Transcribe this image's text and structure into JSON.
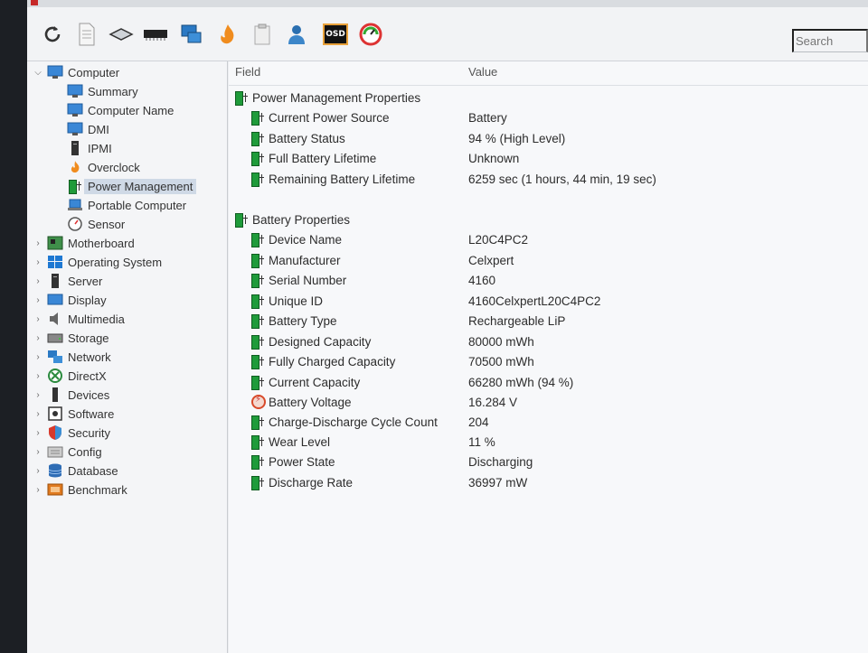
{
  "search": {
    "placeholder": "Search"
  },
  "toolbar": {
    "buttons": [
      "refresh-icon",
      "report-icon",
      "motherboard-icon",
      "memory-icon",
      "network-icon",
      "flame-icon",
      "clipboard-icon",
      "user-icon",
      "osd-icon",
      "gauge-icon"
    ],
    "osd_label": "OSD"
  },
  "sidebar": {
    "items": [
      {
        "label": "Computer",
        "icon": "computer-icon"
      },
      {
        "label": "Summary",
        "icon": "monitor-icon"
      },
      {
        "label": "Computer Name",
        "icon": "monitor-icon"
      },
      {
        "label": "DMI",
        "icon": "monitor-icon"
      },
      {
        "label": "IPMI",
        "icon": "server-icon"
      },
      {
        "label": "Overclock",
        "icon": "flame-icon"
      },
      {
        "label": "Power Management",
        "icon": "battery-icon"
      },
      {
        "label": "Portable Computer",
        "icon": "laptop-icon"
      },
      {
        "label": "Sensor",
        "icon": "gauge-icon"
      },
      {
        "label": "Motherboard",
        "icon": "motherboard-icon"
      },
      {
        "label": "Operating System",
        "icon": "windows-icon"
      },
      {
        "label": "Server",
        "icon": "server-icon"
      },
      {
        "label": "Display",
        "icon": "display-icon"
      },
      {
        "label": "Multimedia",
        "icon": "speaker-icon"
      },
      {
        "label": "Storage",
        "icon": "disk-icon"
      },
      {
        "label": "Network",
        "icon": "network-icon"
      },
      {
        "label": "DirectX",
        "icon": "xbox-icon"
      },
      {
        "label": "Devices",
        "icon": "devices-icon"
      },
      {
        "label": "Software",
        "icon": "software-icon"
      },
      {
        "label": "Security",
        "icon": "shield-icon"
      },
      {
        "label": "Config",
        "icon": "config-icon"
      },
      {
        "label": "Database",
        "icon": "database-icon"
      },
      {
        "label": "Benchmark",
        "icon": "benchmark-icon"
      }
    ]
  },
  "table": {
    "headers": {
      "field": "Field",
      "value": "Value"
    },
    "groups": [
      {
        "title": "Power Management Properties",
        "rows": [
          {
            "field": "Current Power Source",
            "value": "Battery"
          },
          {
            "field": "Battery Status",
            "value": "94 % (High Level)"
          },
          {
            "field": "Full Battery Lifetime",
            "value": "Unknown"
          },
          {
            "field": "Remaining Battery Lifetime",
            "value": "6259 sec (1 hours, 44 min, 19 sec)"
          }
        ]
      },
      {
        "title": "Battery Properties",
        "rows": [
          {
            "field": "Device Name",
            "value": "L20C4PC2"
          },
          {
            "field": "Manufacturer",
            "value": "Celxpert"
          },
          {
            "field": "Serial Number",
            "value": "4160"
          },
          {
            "field": "Unique ID",
            "value": "4160CelxpertL20C4PC2"
          },
          {
            "field": "Battery Type",
            "value": "Rechargeable LiP"
          },
          {
            "field": "Designed Capacity",
            "value": "80000 mWh"
          },
          {
            "field": "Fully Charged Capacity",
            "value": "70500 mWh"
          },
          {
            "field": "Current Capacity",
            "value": "66280 mWh  (94 %)"
          },
          {
            "field": "Battery Voltage",
            "value": "16.284 V",
            "icon": "voltage-icon"
          },
          {
            "field": "Charge-Discharge Cycle Count",
            "value": "204"
          },
          {
            "field": "Wear Level",
            "value": "11 %"
          },
          {
            "field": "Power State",
            "value": "Discharging"
          },
          {
            "field": "Discharge Rate",
            "value": "36997 mW"
          }
        ]
      }
    ]
  }
}
